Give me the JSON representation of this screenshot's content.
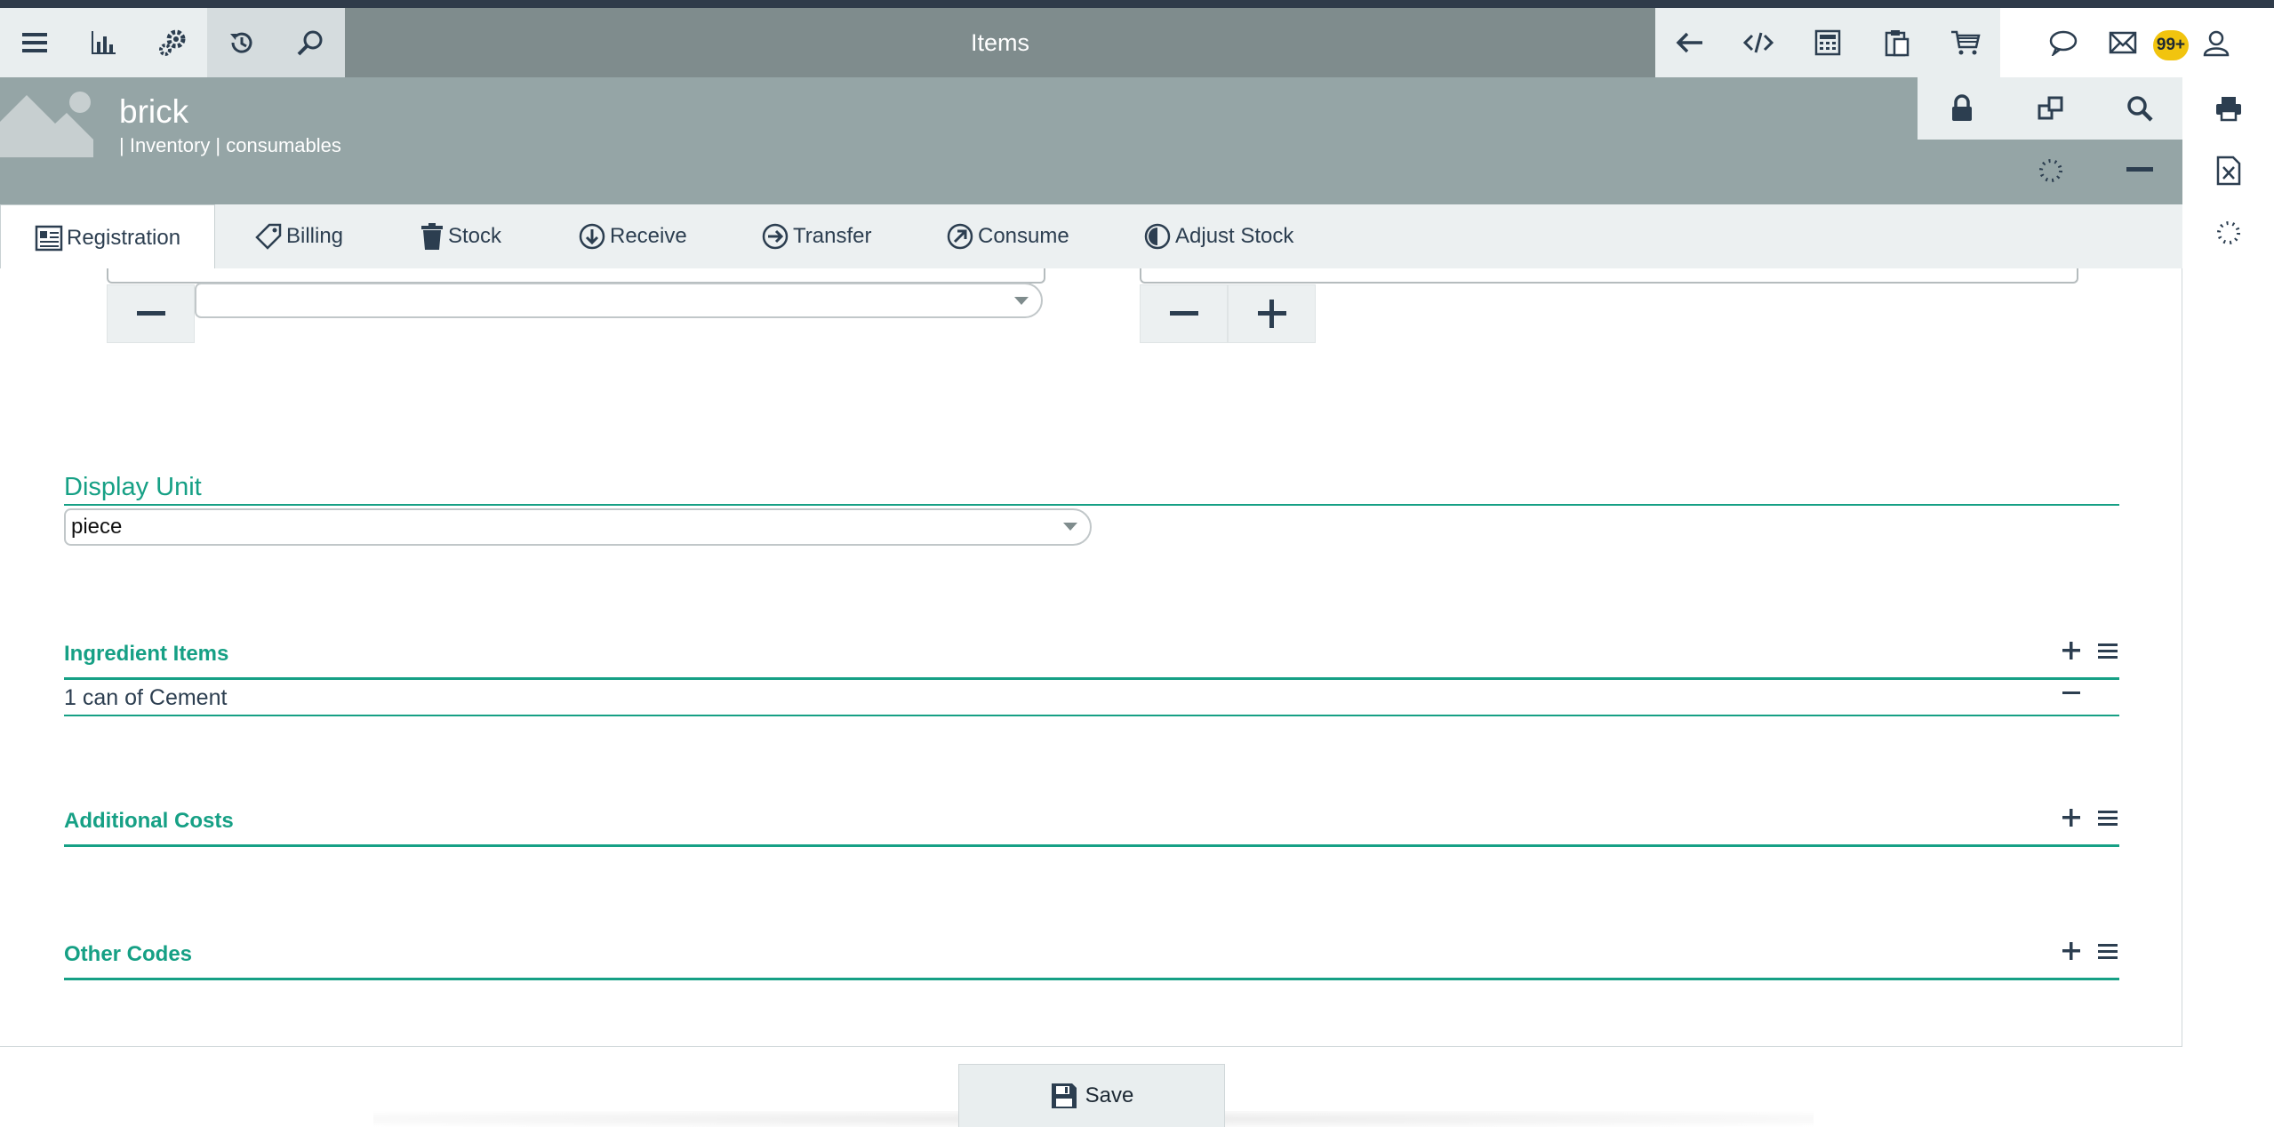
{
  "navbar": {
    "title": "Items",
    "left_icons": [
      "menu-icon",
      "chart-icon",
      "gears-icon",
      "history-icon",
      "search-icon"
    ],
    "right_icons": [
      "back-arrow-icon",
      "code-icon",
      "calculator-icon",
      "clipboard-icon",
      "cart-icon"
    ],
    "far_icons": [
      "chat-icon",
      "mail-icon",
      "user-icon"
    ],
    "badge": "99+"
  },
  "header": {
    "item_name": "brick",
    "item_path": "| Inventory | consumables"
  },
  "tabs": [
    {
      "label": "Registration",
      "icon": "registration-icon"
    },
    {
      "label": "Billing",
      "icon": "tag-icon"
    },
    {
      "label": "Stock",
      "icon": "trash-icon"
    },
    {
      "label": "Receive",
      "icon": "arrow-down-circle-icon"
    },
    {
      "label": "Transfer",
      "icon": "arrow-right-circle-icon"
    },
    {
      "label": "Consume",
      "icon": "arrow-up-right-circle-icon"
    },
    {
      "label": "Adjust Stock",
      "icon": "adjust-icon"
    }
  ],
  "form": {
    "top_select_value": "",
    "display_unit": {
      "label": "Display Unit",
      "value": "piece"
    },
    "ingredient_items": {
      "title": "Ingredient Items",
      "rows": [
        "1 can of Cement"
      ]
    },
    "additional_costs": {
      "title": "Additional Costs"
    },
    "other_codes": {
      "title": "Other Codes"
    }
  },
  "footer": {
    "save_label": "Save"
  },
  "colors": {
    "accent": "#16a085",
    "navbar": "#7f8c8d",
    "header": "#95a5a6",
    "badge": "#f1c40f"
  }
}
